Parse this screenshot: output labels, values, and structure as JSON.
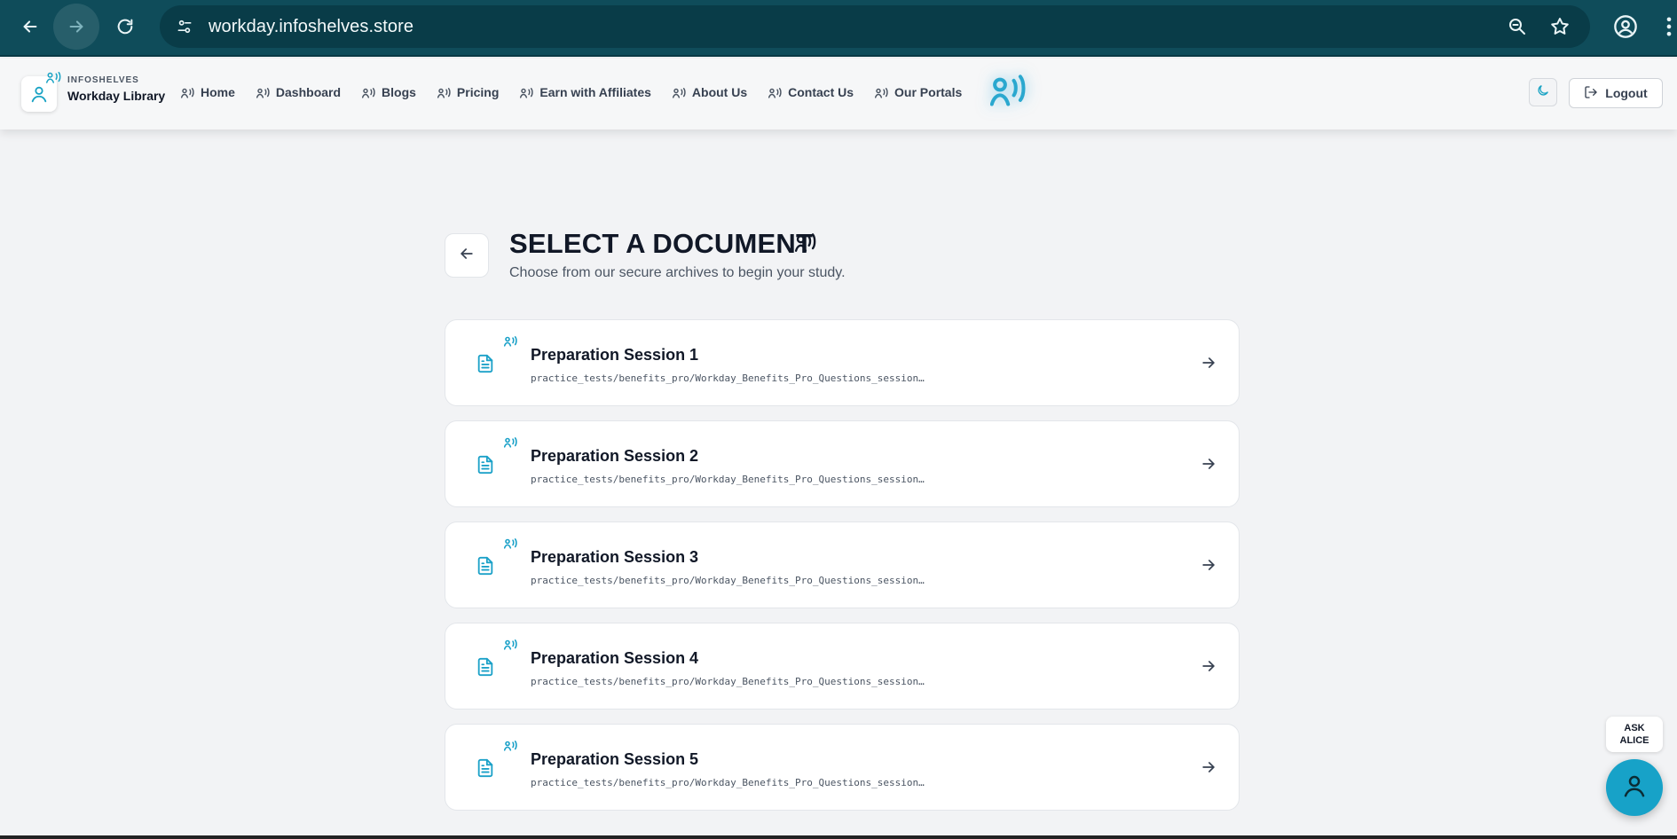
{
  "browser": {
    "url": "workday.infoshelves.store"
  },
  "header": {
    "brand_kicker": "INFOSHELVES",
    "brand_title": "Workday Library",
    "nav": [
      {
        "label": "Home"
      },
      {
        "label": "Dashboard"
      },
      {
        "label": "Blogs"
      },
      {
        "label": "Pricing"
      },
      {
        "label": "Earn with Affiliates"
      },
      {
        "label": "About Us"
      },
      {
        "label": "Contact Us"
      },
      {
        "label": "Our Portals"
      }
    ],
    "logout_label": "Logout"
  },
  "main": {
    "title": "SELECT A DOCUMENT",
    "subtitle": "Choose from our secure archives to begin your study.",
    "documents": [
      {
        "title": "Preparation Session 1",
        "path": "practice_tests/benefits_pro/Workday_Benefits_Pro_Questions_session…"
      },
      {
        "title": "Preparation Session 2",
        "path": "practice_tests/benefits_pro/Workday_Benefits_Pro_Questions_session…"
      },
      {
        "title": "Preparation Session 3",
        "path": "practice_tests/benefits_pro/Workday_Benefits_Pro_Questions_session…"
      },
      {
        "title": "Preparation Session 4",
        "path": "practice_tests/benefits_pro/Workday_Benefits_Pro_Questions_session…"
      },
      {
        "title": "Preparation Session 5",
        "path": "practice_tests/benefits_pro/Workday_Benefits_Pro_Questions_session…"
      }
    ]
  },
  "assistant": {
    "label_line1": "ASK",
    "label_line2": "ALICE"
  },
  "colors": {
    "browser_bar": "#0f4c5a",
    "accent": "#17a2c8",
    "page_bg": "#f2f3f5"
  },
  "icons": [
    "back-arrow-icon",
    "forward-arrow-icon",
    "reload-icon",
    "site-settings-icon",
    "zoom-icon",
    "bookmark-star-icon",
    "profile-icon",
    "menu-kebab-icon",
    "user-icon",
    "signal-icon",
    "moon-icon",
    "logout-icon",
    "document-icon",
    "arrow-right-icon",
    "person-icon"
  ]
}
